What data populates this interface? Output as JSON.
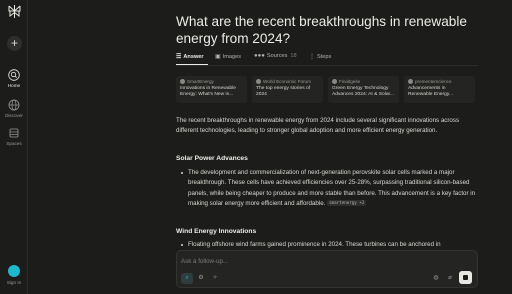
{
  "sidebar": {
    "new_label": "+",
    "items": [
      {
        "label": "Home"
      },
      {
        "label": "Discover"
      },
      {
        "label": "Spaces"
      }
    ],
    "signin_label": "Sign In"
  },
  "query": {
    "title": "What are the recent breakthroughs in renewable energy from 2024?"
  },
  "tabs": [
    {
      "label": "Answer"
    },
    {
      "label": "Images"
    },
    {
      "label": "Sources",
      "count": "18"
    },
    {
      "label": "Steps"
    }
  ],
  "sources": [
    {
      "site": "SmartEnergy",
      "title": "Innovations in Renewable Energy: What's New in..."
    },
    {
      "site": "World Economic Forum",
      "title": "The top energy stories of 2024"
    },
    {
      "site": "Finaltgeite",
      "title": "Green Energy Technology Advances 2024: AI & Solar..."
    },
    {
      "site": "prementerscience",
      "title": "Advancements in Renewable Energy..."
    }
  ],
  "answer": {
    "intro": "The recent breakthroughs in renewable energy from 2024 include several significant innovations across different technologies, leading to stronger global adoption and more efficient energy generation.",
    "solar_heading": "Solar Power Advances",
    "solar_bullet": "The development and commercialization of next-generation perovskite solar cells marked a major breakthrough. These cells have achieved efficiencies over 25-28%, surpassing traditional silicon-based panels, while being cheaper to produce and more stable than before. This advancement is a key factor in making solar energy more efficient and affordable.",
    "solar_cite": "smartenergy +2",
    "wind_heading": "Wind Energy Innovations",
    "wind_bullet": "Floating offshore wind farms gained prominence in 2024. These turbines can be anchored in"
  },
  "followup": {
    "placeholder": "Ask a follow-up..."
  },
  "colors": {
    "accent": "#20b8cd",
    "background": "#1c1c1a",
    "card": "#242422"
  }
}
